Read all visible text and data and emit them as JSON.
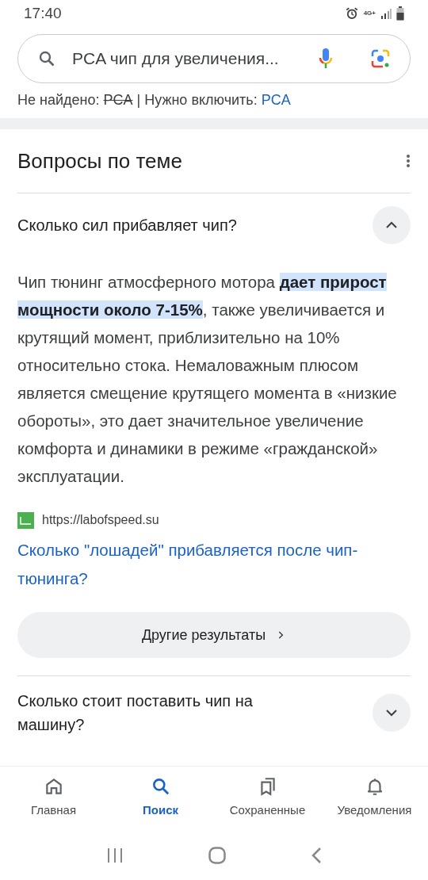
{
  "status_bar": {
    "time": "17:40",
    "network": "4G+"
  },
  "search": {
    "value": "PCA чип для увеличения..."
  },
  "spelling": {
    "not_found_label": "Не найдено:",
    "not_found_term": "PCA",
    "separator": "|",
    "include_label": "Нужно включить:",
    "include_term": "PCA"
  },
  "section": {
    "title": "Вопросы по теме",
    "questions": [
      {
        "text": "Сколько сил прибавляет чип?",
        "expanded": true,
        "answer": "Чип тюнинг атмосферного мотора **дает прирост мощности около 7-15%**, также увеличивается и крутящий момент, приблизительно на 10% относительно стока. Немаловажным плюсом является смещение крутящего момента в «низкие обороты», это дает значительное увеличение комфорта и динамики в режиме «гражданской» эксплуатации.",
        "source_url": "https://labofspeed.su",
        "source_title": "Сколько \"лошадей\" прибавляется после чип-тюнинга?",
        "more_button": "Другие результаты"
      },
      {
        "text": "Сколько стоит поставить чип на машину?",
        "expanded": false
      }
    ]
  },
  "bottom_nav": [
    {
      "label": "Главная",
      "kind": "home",
      "selected": false
    },
    {
      "label": "Поиск",
      "kind": "search",
      "selected": true
    },
    {
      "label": "Сохраненные",
      "kind": "saved",
      "selected": false
    },
    {
      "label": "Уведомления",
      "kind": "bell",
      "selected": false
    }
  ]
}
